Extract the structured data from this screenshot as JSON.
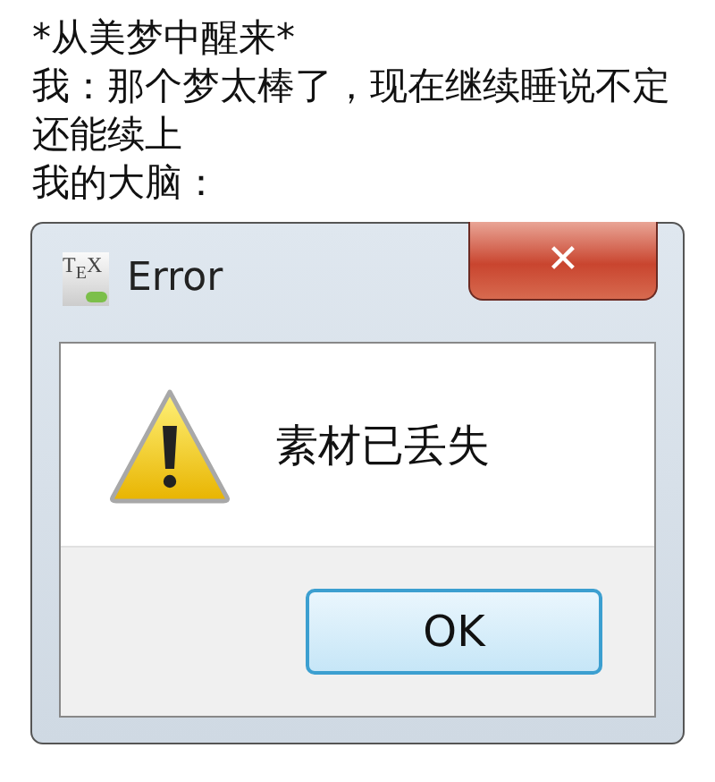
{
  "caption": [
    "*从美梦中醒来*",
    "我：那个梦太棒了，现在继续睡说不定还能续上",
    "我的大脑："
  ],
  "dialog": {
    "icon_text": "T$_{E}$X",
    "title": "Error",
    "close": "✕",
    "message": "素材已丢失",
    "buttons": [
      "OK"
    ]
  }
}
